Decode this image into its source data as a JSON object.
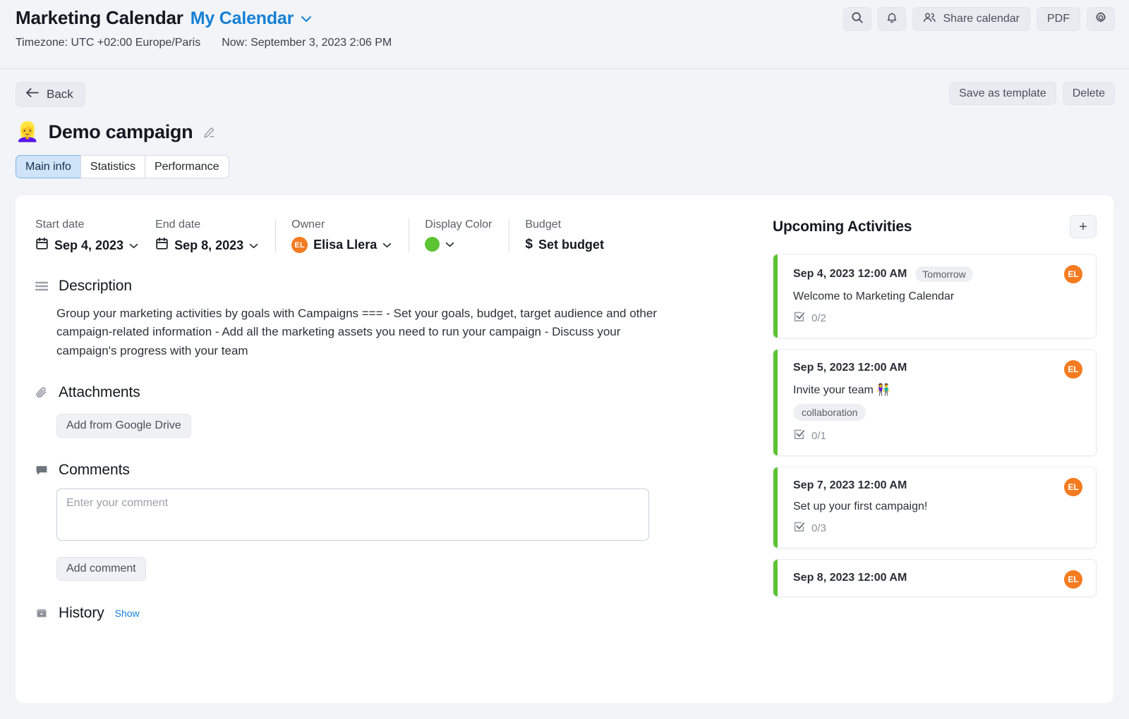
{
  "header": {
    "app_title": "Marketing Calendar",
    "calendar_name": "My Calendar",
    "caret": "⌄",
    "timezone": "Timezone: UTC +02:00 Europe/Paris",
    "now": "Now: September 3, 2023 2:06 PM",
    "actions": {
      "search_icon": "search-icon",
      "bell_icon": "bell-icon",
      "share_label": "Share calendar",
      "share_icon": "people-icon",
      "pdf_label": "PDF",
      "settings_icon": "gear-icon"
    }
  },
  "subheader": {
    "back_label": "Back",
    "back_icon": "arrow-left-icon",
    "save_template_label": "Save as template",
    "delete_label": "Delete"
  },
  "campaign": {
    "emoji": "👱‍♀️",
    "title": "Demo campaign",
    "edit_icon": "pencil-icon",
    "tabs": [
      {
        "label": "Main info",
        "active": true
      },
      {
        "label": "Statistics",
        "active": false
      },
      {
        "label": "Performance",
        "active": false
      }
    ]
  },
  "meta": {
    "start": {
      "label": "Start date",
      "value": "Sep 4, 2023",
      "icon": "calendar-icon"
    },
    "end": {
      "label": "End date",
      "value": "Sep 8, 2023",
      "icon": "calendar-icon"
    },
    "owner": {
      "label": "Owner",
      "value": "Elisa Llera",
      "initials": "EL",
      "avatar_color": "#F47B20"
    },
    "color": {
      "label": "Display Color",
      "value": "#5CC433"
    },
    "budget": {
      "label": "Budget",
      "value": "Set budget",
      "currency": "$"
    },
    "caret": "⌄"
  },
  "description": {
    "title": "Description",
    "icon": "list-icon",
    "text": "Group your marketing activities by goals with Campaigns === - Set your goals, budget, target audience and other campaign-related information - Add all the marketing assets you need to run your campaign - Discuss your campaign's progress with your team"
  },
  "attachments": {
    "title": "Attachments",
    "icon": "paperclip-icon",
    "button_label": "Add from Google Drive"
  },
  "comments": {
    "title": "Comments",
    "icon": "comment-icon",
    "placeholder": "Enter your comment",
    "value": "",
    "button_label": "Add comment"
  },
  "history": {
    "title": "History",
    "icon": "archive-icon",
    "show_label": "Show"
  },
  "activities": {
    "title": "Upcoming Activities",
    "add_label": "+",
    "items": [
      {
        "date": "Sep 4, 2023 12:00 AM",
        "badge": "Tomorrow",
        "name": "Welcome to Marketing Calendar",
        "tag": "",
        "checklist": "0/2",
        "initials": "EL",
        "bar_color": "#5CC433"
      },
      {
        "date": "Sep 5, 2023 12:00 AM",
        "badge": "",
        "name": "Invite your team 👫",
        "tag": "collaboration",
        "checklist": "0/1",
        "initials": "EL",
        "bar_color": "#5CC433"
      },
      {
        "date": "Sep 7, 2023 12:00 AM",
        "badge": "",
        "name": "Set up your first campaign!",
        "tag": "",
        "checklist": "0/3",
        "initials": "EL",
        "bar_color": "#5CC433"
      },
      {
        "date": "Sep 8, 2023 12:00 AM",
        "badge": "",
        "name": "",
        "tag": "",
        "checklist": "",
        "initials": "EL",
        "bar_color": "#5CC433"
      }
    ]
  }
}
